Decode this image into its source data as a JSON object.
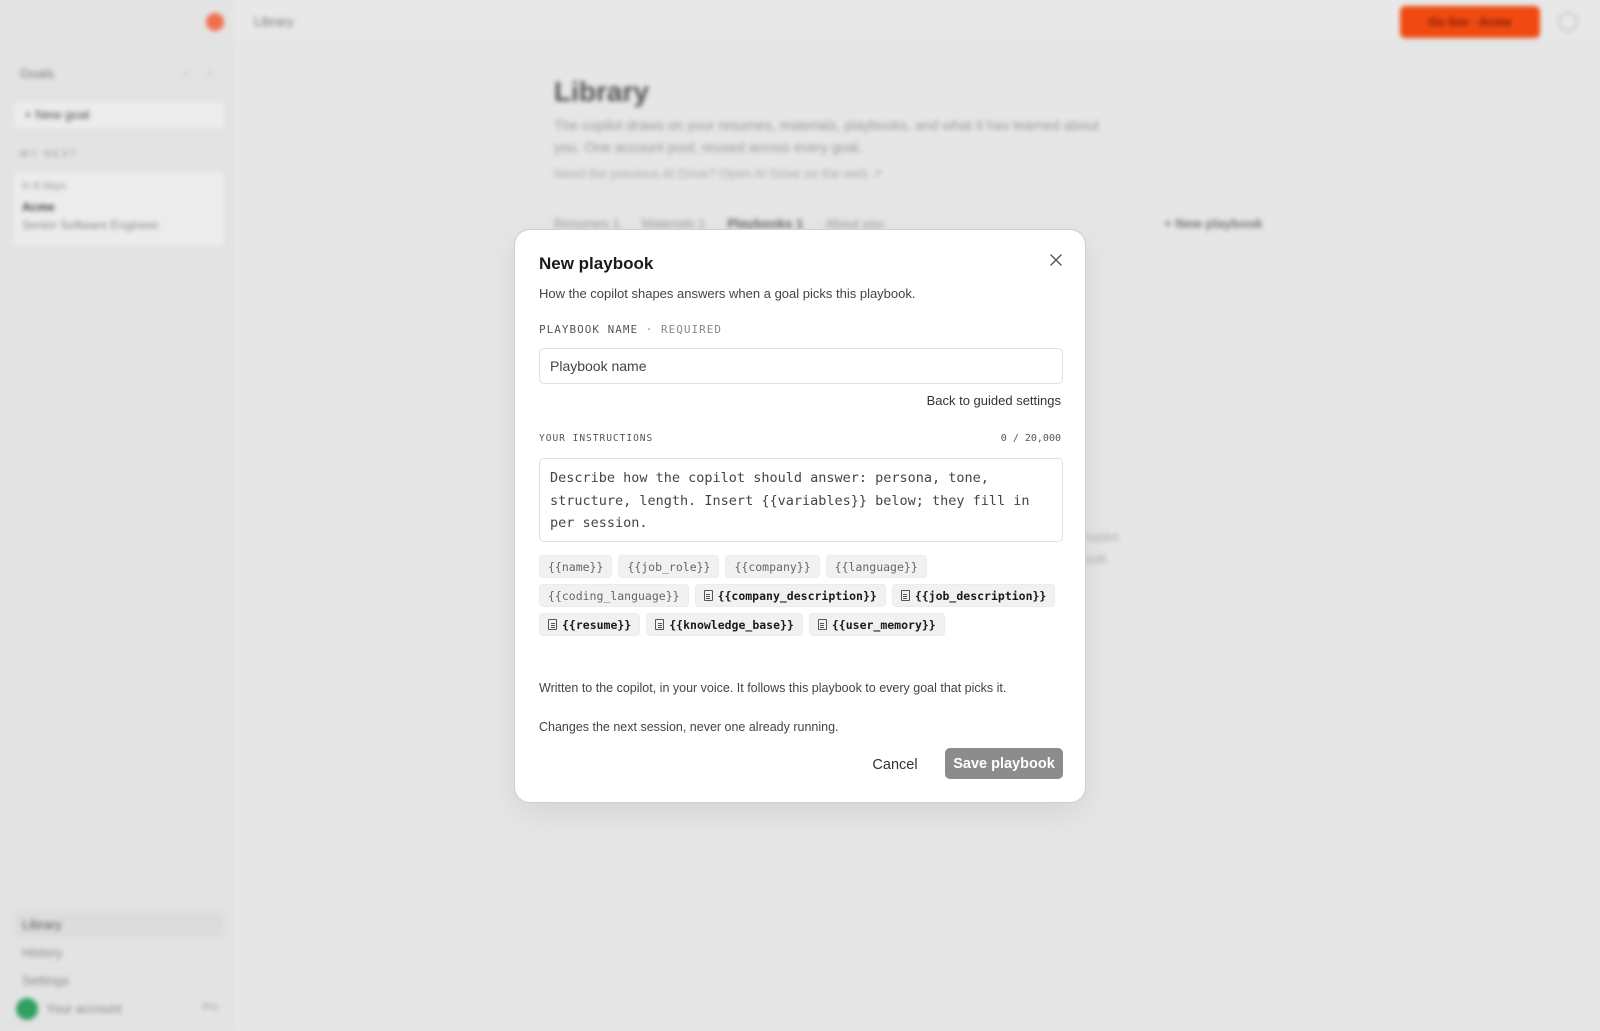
{
  "background": {
    "topbar": {
      "title": "Library",
      "cta_label": "Go live · Acme",
      "help_icon": "help-circle-icon"
    },
    "sidebar": {
      "heading": "Goals",
      "arrows": "‹ ›",
      "new_goal_label": "+ New goal",
      "section_label": "MY NEXT",
      "goal_card": {
        "meta": "in 8 days",
        "company": "Acme",
        "role": "Senior Software Engineer"
      },
      "nav": [
        {
          "label": "Library",
          "icon": "book-icon"
        },
        {
          "label": "History",
          "icon": "clock-icon"
        },
        {
          "label": "Settings",
          "icon": "gear-icon"
        }
      ],
      "account": {
        "name": "Your account",
        "badge": "Pro"
      }
    },
    "main": {
      "title": "Library",
      "description": "The copilot draws on your resumes, materials, playbooks, and what it has learned about you. One account pool, reused across every goal.",
      "link": "Need the previous AI Drive? Open AI Drive on the web ↗",
      "tabs": [
        {
          "label": "Resumes 1"
        },
        {
          "label": "Materials 1"
        },
        {
          "label": "Playbooks 1",
          "active": true
        },
        {
          "label": "About you"
        }
      ],
      "new_playbook_label": "+ New playbook",
      "fragment_line1": "copilot",
      "fragment_line2": "built."
    }
  },
  "modal": {
    "title": "New playbook",
    "subtitle": "How the copilot shapes answers when a goal picks this playbook.",
    "close_icon": "close-icon",
    "name_label": "PLAYBOOK NAME",
    "name_required": "· REQUIRED",
    "name_placeholder": "Playbook name",
    "name_value": "",
    "back_link": "Back to guided settings",
    "instructions_label": "YOUR INSTRUCTIONS",
    "counter": "0 / 20,000",
    "instructions_placeholder": "Describe how the copilot should answer: persona, tone, structure, length. Insert {{variables}} below; they fill in per session.",
    "instructions_value": "",
    "chips": [
      {
        "label": "{{name}}",
        "doc": false
      },
      {
        "label": "{{job_role}}",
        "doc": false
      },
      {
        "label": "{{company}}",
        "doc": false
      },
      {
        "label": "{{language}}",
        "doc": false
      },
      {
        "label": "{{coding_language}}",
        "doc": false
      },
      {
        "label": "{{company_description}}",
        "doc": true
      },
      {
        "label": "{{job_description}}",
        "doc": true
      },
      {
        "label": "{{resume}}",
        "doc": true
      },
      {
        "label": "{{knowledge_base}}",
        "doc": true
      },
      {
        "label": "{{user_memory}}",
        "doc": true
      }
    ],
    "hint_voice": "Written to the copilot, in your voice. It follows this playbook to every goal that picks it.",
    "hint_session": "Changes the next session, never one already running.",
    "cancel_label": "Cancel",
    "save_label": "Save playbook",
    "colors": {
      "save_disabled": "#8c8c8c",
      "accent": "#f04a12"
    }
  }
}
